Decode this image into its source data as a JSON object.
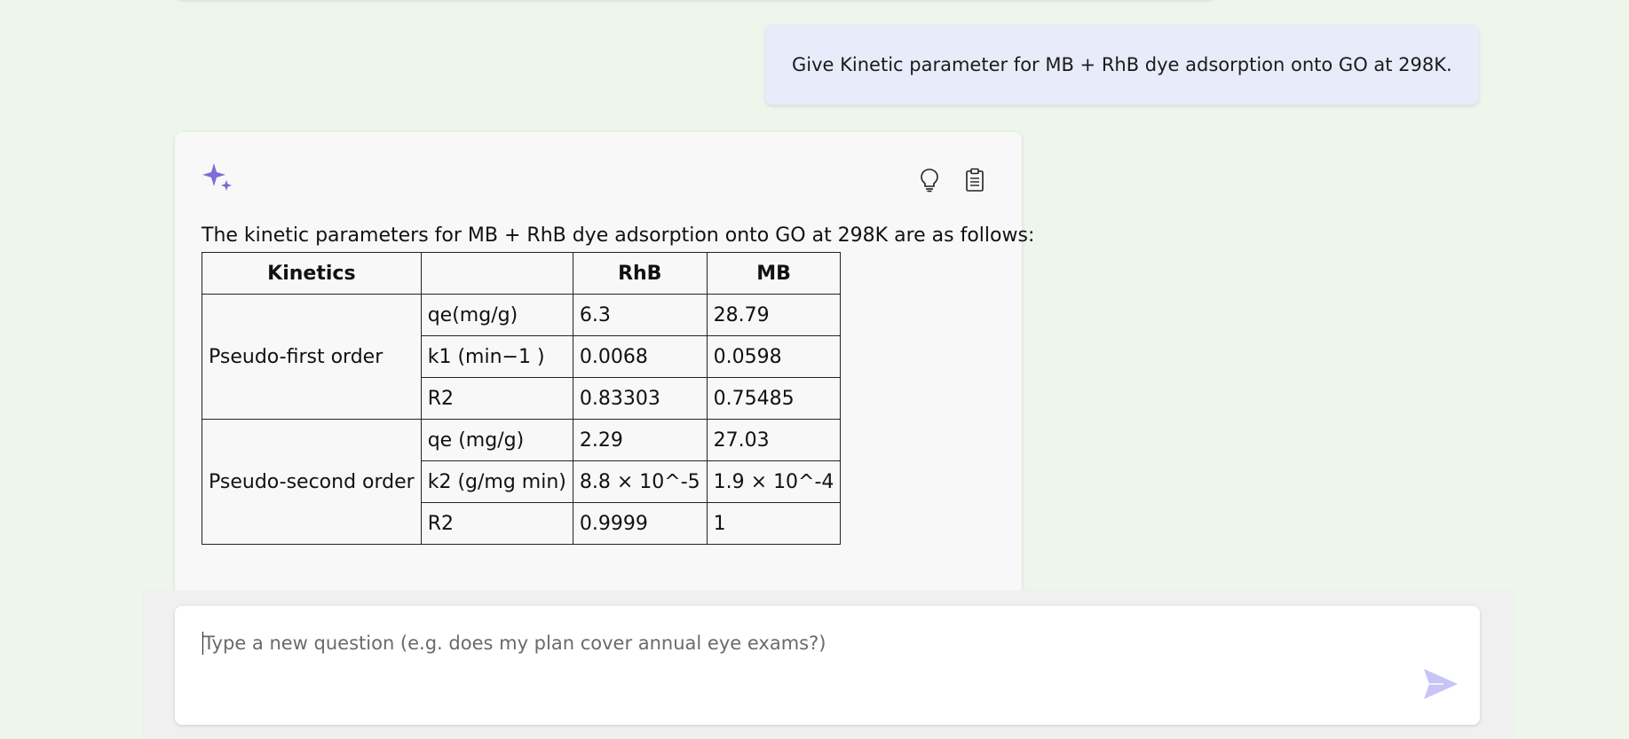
{
  "conversation": {
    "user_question": "Give Kinetic parameter for MB + RhB dye adsorption onto GO at 298K.",
    "answer": {
      "intro": "The kinetic parameters for MB + RhB dye adsorption onto GO at 298K are as follows:",
      "icons": {
        "brand": "sparkle-icon",
        "explain": "lightbulb-icon",
        "copy": "clipboard-icon"
      },
      "table": {
        "headers": [
          "Kinetics",
          "",
          "RhB",
          "MB"
        ],
        "groups": [
          {
            "name": "Pseudo-first order",
            "rows": [
              [
                "qe(mg/g)",
                "6.3",
                "28.79"
              ],
              [
                "k1 (min−1 )",
                "0.0068",
                "0.0598"
              ],
              [
                "R2",
                "0.83303",
                "0.75485"
              ]
            ]
          },
          {
            "name": "Pseudo-second order",
            "rows": [
              [
                "qe (mg/g)",
                "2.29",
                "27.03"
              ],
              [
                "k2 (g/mg min)",
                "8.8 × 10^-5",
                "1.9 × 10^-4"
              ],
              [
                "R2",
                "0.9999",
                "1"
              ]
            ]
          }
        ]
      }
    }
  },
  "input": {
    "placeholder": "Type a new question (e.g. does my plan cover annual eye exams?)",
    "value": "",
    "send_icon": "send-icon"
  },
  "colors": {
    "page_background": "#eef6ec",
    "user_bubble": "#e8ebfa",
    "answer_card": "#f8f8f8",
    "accent": "#7f6cd6",
    "send_icon": "#c8c4f5"
  }
}
